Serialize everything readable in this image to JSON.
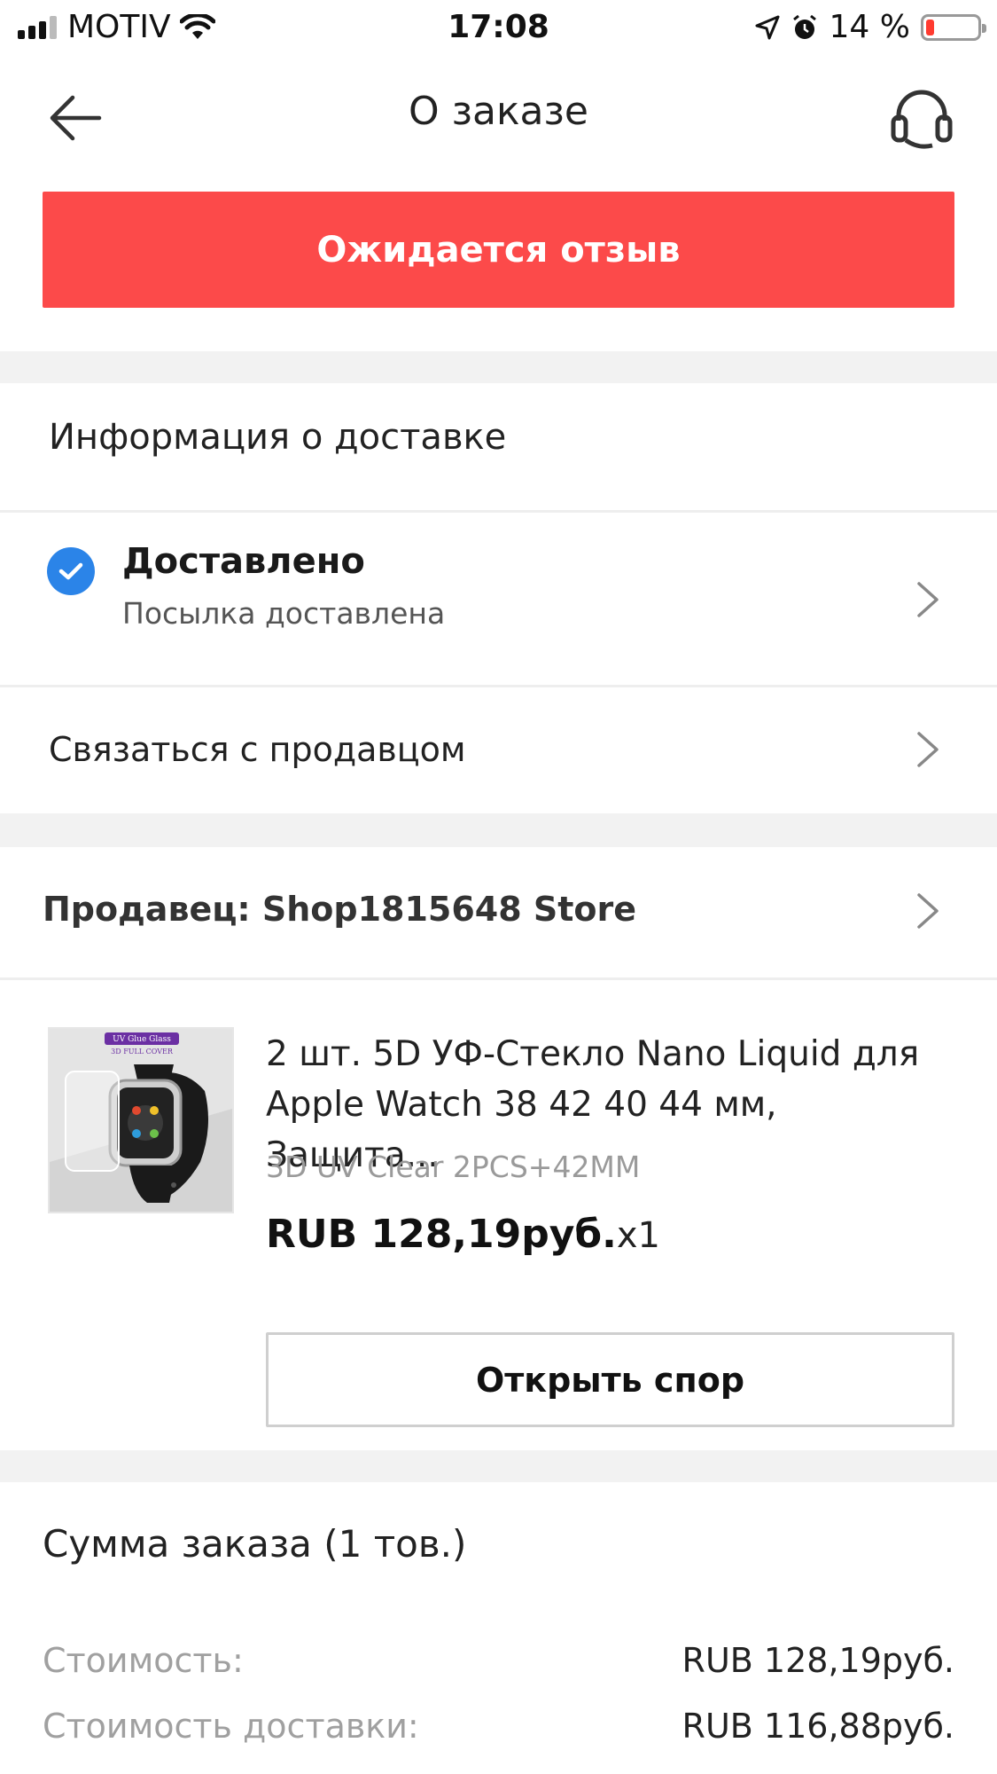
{
  "status_bar": {
    "carrier": "MOTIV",
    "time": "17:08",
    "battery": "14 %"
  },
  "nav": {
    "title": "О заказе",
    "back_icon": "arrow-left-icon",
    "support_icon": "headset-icon"
  },
  "status_banner": "Ожидается отзыв",
  "delivery": {
    "section_title": "Информация о доставке",
    "status": "Доставлено",
    "status_detail": "Посылка доставлена",
    "contact_seller": "Связаться с продавцом"
  },
  "seller": {
    "label": "Продавец: Shop1815648 Store"
  },
  "product": {
    "image_caption_1": "UV Glue Glass",
    "image_caption_2": "3D FULL COVER",
    "title": "2 шт. 5D УФ-Стекло Nano Liquid для Apple Watch 38 42 40 44 мм, Защита...",
    "variant": "3D UV Clear 2PCS+42MM",
    "price": "RUB 128,19руб.",
    "quantity": "x1",
    "dispute_button": "Открыть спор"
  },
  "summary": {
    "title": "Сумма заказа (1 тов.)",
    "rows": [
      {
        "label": "Стоимость:",
        "value": "RUB 128,19руб."
      },
      {
        "label": "Стоимость доставки:",
        "value": "RUB 116,88руб."
      }
    ]
  },
  "colors": {
    "banner": "#fc4a4a",
    "check": "#2b84e8",
    "section_gap": "#f2f2f2"
  }
}
